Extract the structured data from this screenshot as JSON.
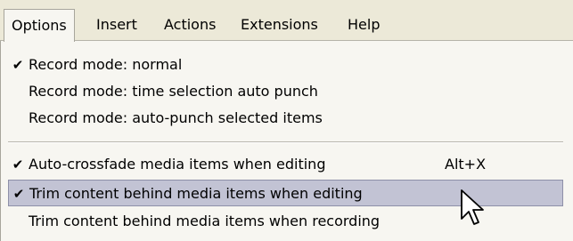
{
  "menubar": {
    "items": [
      {
        "label": "Options"
      },
      {
        "label": "Insert"
      },
      {
        "label": "Actions"
      },
      {
        "label": "Extensions"
      },
      {
        "label": "Help"
      }
    ]
  },
  "menu": {
    "check_glyph": "✔",
    "items": [
      {
        "label": "Record mode: normal",
        "checked": true
      },
      {
        "label": "Record mode: time selection auto punch",
        "checked": false
      },
      {
        "label": "Record mode: auto-punch selected items",
        "checked": false
      },
      {
        "label": "Auto-crossfade media items when editing",
        "checked": true,
        "shortcut": "Alt+X"
      },
      {
        "label": "Trim content behind media items when editing",
        "checked": true,
        "highlighted": true
      },
      {
        "label": "Trim content behind media items when recording",
        "checked": false
      }
    ]
  },
  "cursor": {
    "icon": "arrow-pointer-icon"
  }
}
